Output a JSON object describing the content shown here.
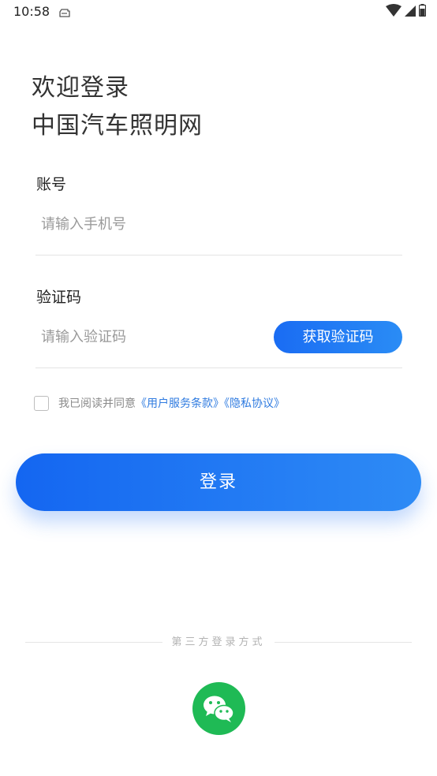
{
  "status_bar": {
    "time": "10:58",
    "icons": [
      "notification-icon",
      "wifi-icon",
      "signal-icon",
      "battery-icon"
    ]
  },
  "header": {
    "welcome_line1": "欢迎登录",
    "welcome_line2": "中国汽车照明网"
  },
  "form": {
    "account_label": "账号",
    "phone_placeholder": "请输入手机号",
    "phone_value": "",
    "code_label": "验证码",
    "code_placeholder": "请输入验证码",
    "code_value": "",
    "get_code_label": "获取验证码"
  },
  "agreement": {
    "checked": false,
    "prefix": "我已阅读并同意",
    "terms_link": "《用户服务条款》",
    "privacy_link": "《隐私协议》"
  },
  "login_button": "登录",
  "third_party": {
    "title": "第三方登录方式",
    "providers": [
      "wechat-icon"
    ]
  },
  "colors": {
    "primary": "#1A6CF3",
    "primary_light": "#2E8BF5",
    "link": "#2F7BE0",
    "wechat": "#1FBA55"
  }
}
